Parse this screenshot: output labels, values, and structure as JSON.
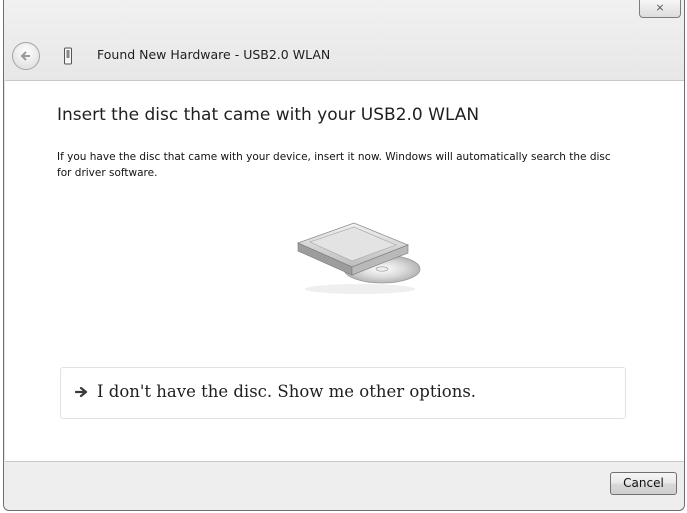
{
  "window": {
    "title": "Found New Hardware - USB2.0 WLAN",
    "close_glyph": "⨯"
  },
  "main": {
    "heading": "Insert the disc that came with your USB2.0 WLAN",
    "description": "If you have the disc that came with your device, insert it now.  Windows will automatically search the disc for driver software.",
    "option_text": "I don't have the disc.  Show me other options."
  },
  "footer": {
    "cancel_label": "Cancel"
  },
  "icons": {
    "back": "back-arrow-icon",
    "hardware": "usb-device-icon",
    "disc": "disc-drive-icon",
    "option_arrow": "right-arrow-icon"
  }
}
